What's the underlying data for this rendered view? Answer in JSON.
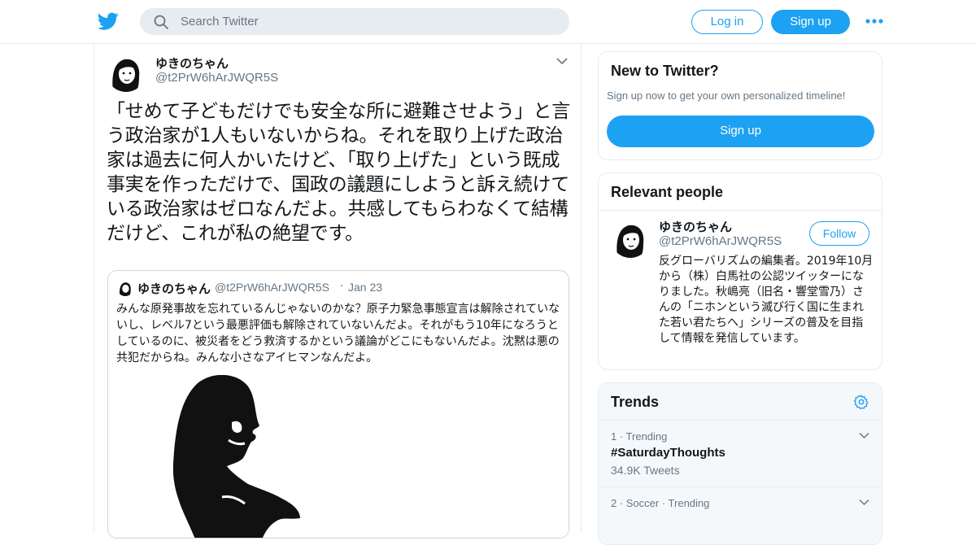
{
  "header": {
    "search_placeholder": "Search Twitter",
    "login_label": "Log in",
    "signup_label": "Sign up",
    "brand_color": "#1da1f2"
  },
  "tweet": {
    "author_name": "ゆきのちゃん",
    "author_handle": "@t2PrW6hArJWQR5S",
    "text": "「せめて子どもだけでも安全な所に避難させよう」と言う政治家が1人もいないからね。それを取り上げた政治家は過去に何人かいたけど、「取り上げた」という既成事実を作っただけで、国政の議題にしようと訴え続けている政治家はゼロなんだよ。共感してもらわなくて結構だけど、これが私の絶望です。",
    "quoted": {
      "author_name": "ゆきのちゃん",
      "author_handle": "@t2PrW6hArJWQR5S",
      "separator": "·",
      "date": "Jan 23",
      "text": "みんな原発事故を忘れているんじゃないのかな？原子力緊急事態宣言は解除されていないし、レベル7という最悪評価も解除されていないんだよ。それがもう10年になろうとしているのに、被災者をどう救済するかという議論がどこにもないんだよ。沈黙は悪の共犯だからね。みんな小さなアイヒマンなんだよ。"
    }
  },
  "sidebar": {
    "new_to_twitter": {
      "title": "New to Twitter?",
      "subtitle": "Sign up now to get your own personalized timeline!",
      "signup_label": "Sign up"
    },
    "relevant_people": {
      "title": "Relevant people",
      "person": {
        "name": "ゆきのちゃん",
        "handle": "@t2PrW6hArJWQR5S",
        "follow_label": "Follow",
        "bio": "反グローバリズムの編集者。2019年10月から（株）白馬社の公認ツイッターになりました。秋嶋亮（旧名・響堂雪乃）さんの「ニホンという滅び行く国に生まれた若い君たちへ」シリーズの普及を目指して情報を発信しています。"
      }
    },
    "trends": {
      "title": "Trends",
      "items": [
        {
          "meta": "1 · Trending",
          "name": "#SaturdayThoughts",
          "count": "34.9K Tweets"
        },
        {
          "meta": "2 · Soccer · Trending",
          "name": "",
          "count": ""
        }
      ]
    }
  }
}
